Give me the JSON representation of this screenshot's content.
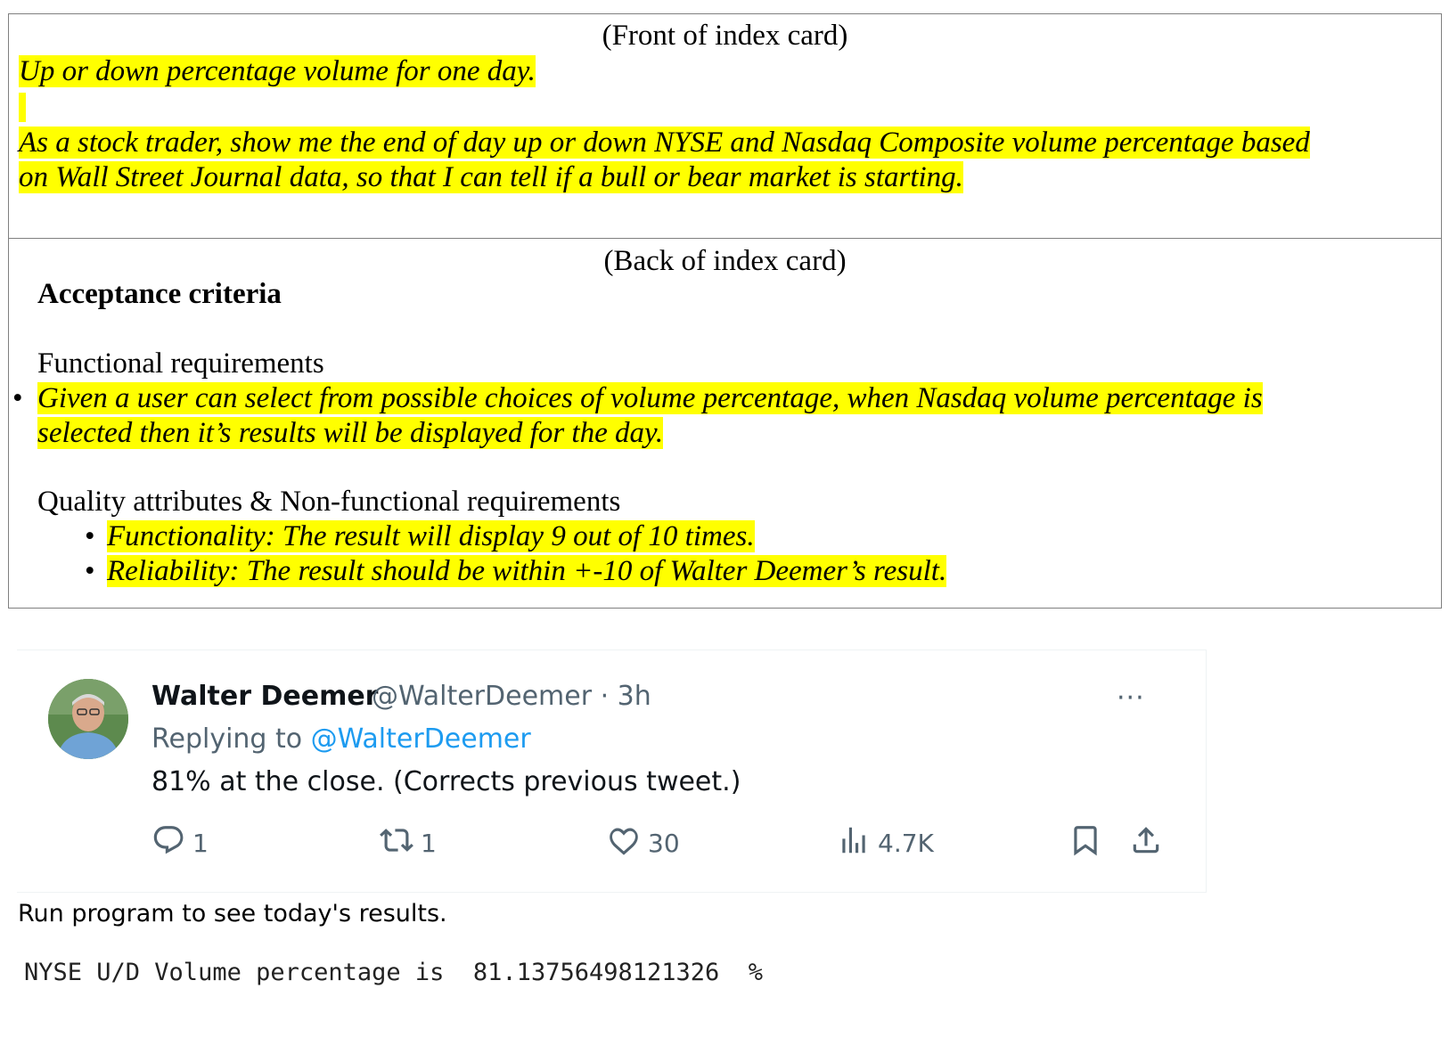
{
  "card": {
    "front": {
      "heading": "(Front of index card)",
      "story_title": "Up or down percentage volume for one day.",
      "story_body_line1": "As a stock trader, show me the end of day up or down NYSE and Nasdaq Composite volume percentage based",
      "story_body_line2": "on Wall Street Journal data, so that I can tell if a bull or bear market is starting."
    },
    "back": {
      "heading": "(Back of index card)",
      "acceptance_heading": "Acceptance criteria",
      "functional_heading": "Functional requirements",
      "functional_items": [
        {
          "line1": "Given a user can select from possible choices of volume percentage, when Nasdaq volume percentage is",
          "line2": "selected then it’s results will be displayed for the day."
        }
      ],
      "quality_heading": "Quality attributes & Non-functional requirements",
      "quality_items": [
        "Functionality: The result will display 9 out of 10 times.",
        "Reliability: The result should be within +-10 of Walter Deemer’s result."
      ],
      "bullet": "•"
    }
  },
  "tweet": {
    "author_name": "Walter Deemer",
    "author_meta": "@WalterDeemer · 3h",
    "replying_prefix": "Replying to ",
    "replying_handle": "@WalterDeemer",
    "text": "81% at the close. (Corrects previous tweet.)",
    "more": "···",
    "actions": {
      "reply_count": "1",
      "retweet_count": "1",
      "like_count": "30",
      "views_count": "4.7K"
    },
    "icons": [
      "reply-icon",
      "retweet-icon",
      "heart-icon",
      "views-icon",
      "bookmark-icon",
      "share-icon"
    ],
    "colors": {
      "text": "#0f1419",
      "secondary": "#536471",
      "link": "#1d9bf0"
    }
  },
  "caption": "Run program to see today's results.",
  "console": {
    "line": "NYSE U/D Volume percentage is  81.13756498121326  %"
  },
  "colors": {
    "highlight": "#ffff00",
    "border": "#808080"
  }
}
